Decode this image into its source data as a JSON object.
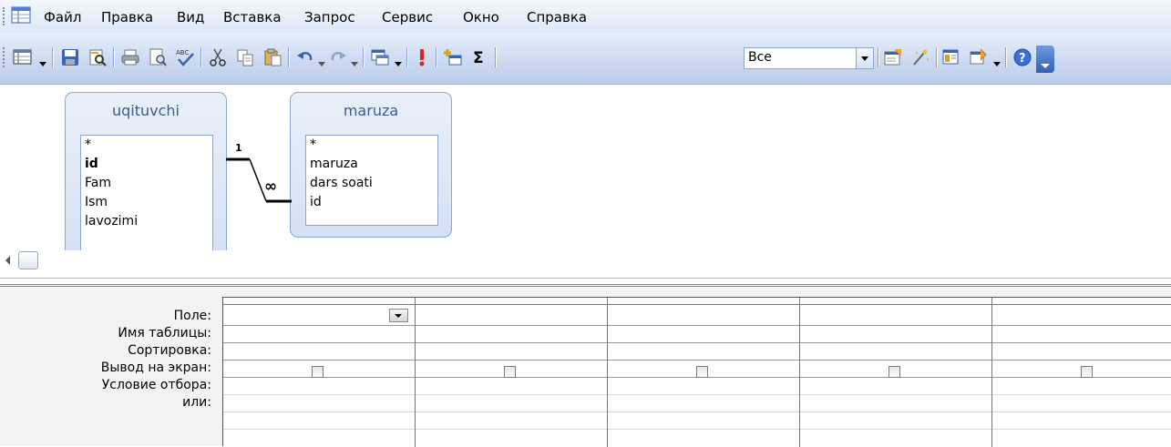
{
  "menu": {
    "items": [
      "Файл",
      "Правка",
      "Вид",
      "Вставка",
      "Запрос",
      "Сервис",
      "Окно",
      "Справка"
    ]
  },
  "toolbar": {
    "top_values_combo": "Все",
    "icons": [
      "view-icon",
      "save-icon",
      "search-icon",
      "print-icon",
      "print-preview-icon",
      "spelling-icon",
      "cut-icon",
      "copy-icon",
      "paste-icon",
      "undo-icon",
      "redo-icon",
      "query-type-icon",
      "run-icon",
      "show-table-icon",
      "totals-icon",
      "properties-icon",
      "builder-icon",
      "database-window-icon",
      "new-object-icon",
      "help-icon"
    ]
  },
  "tables": [
    {
      "name": "uqituvchi",
      "fields": [
        "*",
        "id",
        "Fam",
        "Ism",
        "lavozimi"
      ],
      "primary_key": "id"
    },
    {
      "name": "maruza",
      "fields": [
        "*",
        "maruza",
        "dars soati",
        "id"
      ]
    }
  ],
  "relationship": {
    "one_label": "1",
    "many_label": "∞"
  },
  "design_grid": {
    "row_labels": [
      "Поле:",
      "Имя таблицы:",
      "Сортировка:",
      "Вывод на экран:",
      "Условие отбора:",
      "или:"
    ]
  },
  "colors": {
    "menu_bg": "#dde8f7",
    "toolbar_bg": "#cad9f0",
    "table_title": "#3d5c8f"
  }
}
